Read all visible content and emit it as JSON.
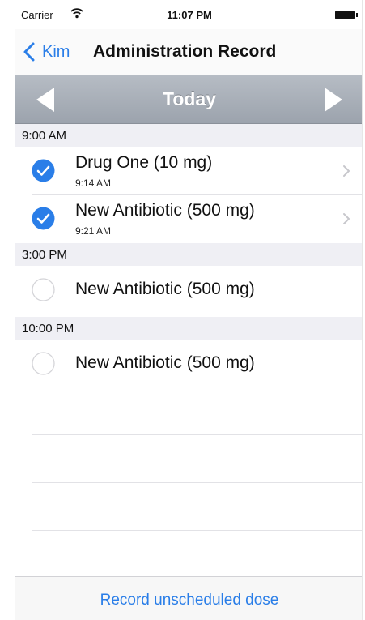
{
  "status_bar": {
    "carrier": "Carrier",
    "time": "11:07 PM"
  },
  "nav": {
    "back_label": "Kim",
    "title": "Administration Record"
  },
  "date_selector": {
    "label": "Today"
  },
  "sections": [
    {
      "header": "9:00 AM",
      "items": [
        {
          "title": "Drug One (10 mg)",
          "time": "9:14 AM",
          "checked": true
        },
        {
          "title": "New Antibiotic (500 mg)",
          "time": "9:21 AM",
          "checked": true
        }
      ]
    },
    {
      "header": "3:00 PM",
      "items": [
        {
          "title": "New Antibiotic (500 mg)",
          "checked": false
        }
      ]
    },
    {
      "header": "10:00 PM",
      "items": [
        {
          "title": "New Antibiotic (500 mg)",
          "checked": false
        }
      ]
    }
  ],
  "toolbar": {
    "record_label": "Record unscheduled dose"
  },
  "colors": {
    "accent": "#2a7ee8",
    "date_bar": "#a9afb8",
    "section_bg": "#efeff4"
  }
}
